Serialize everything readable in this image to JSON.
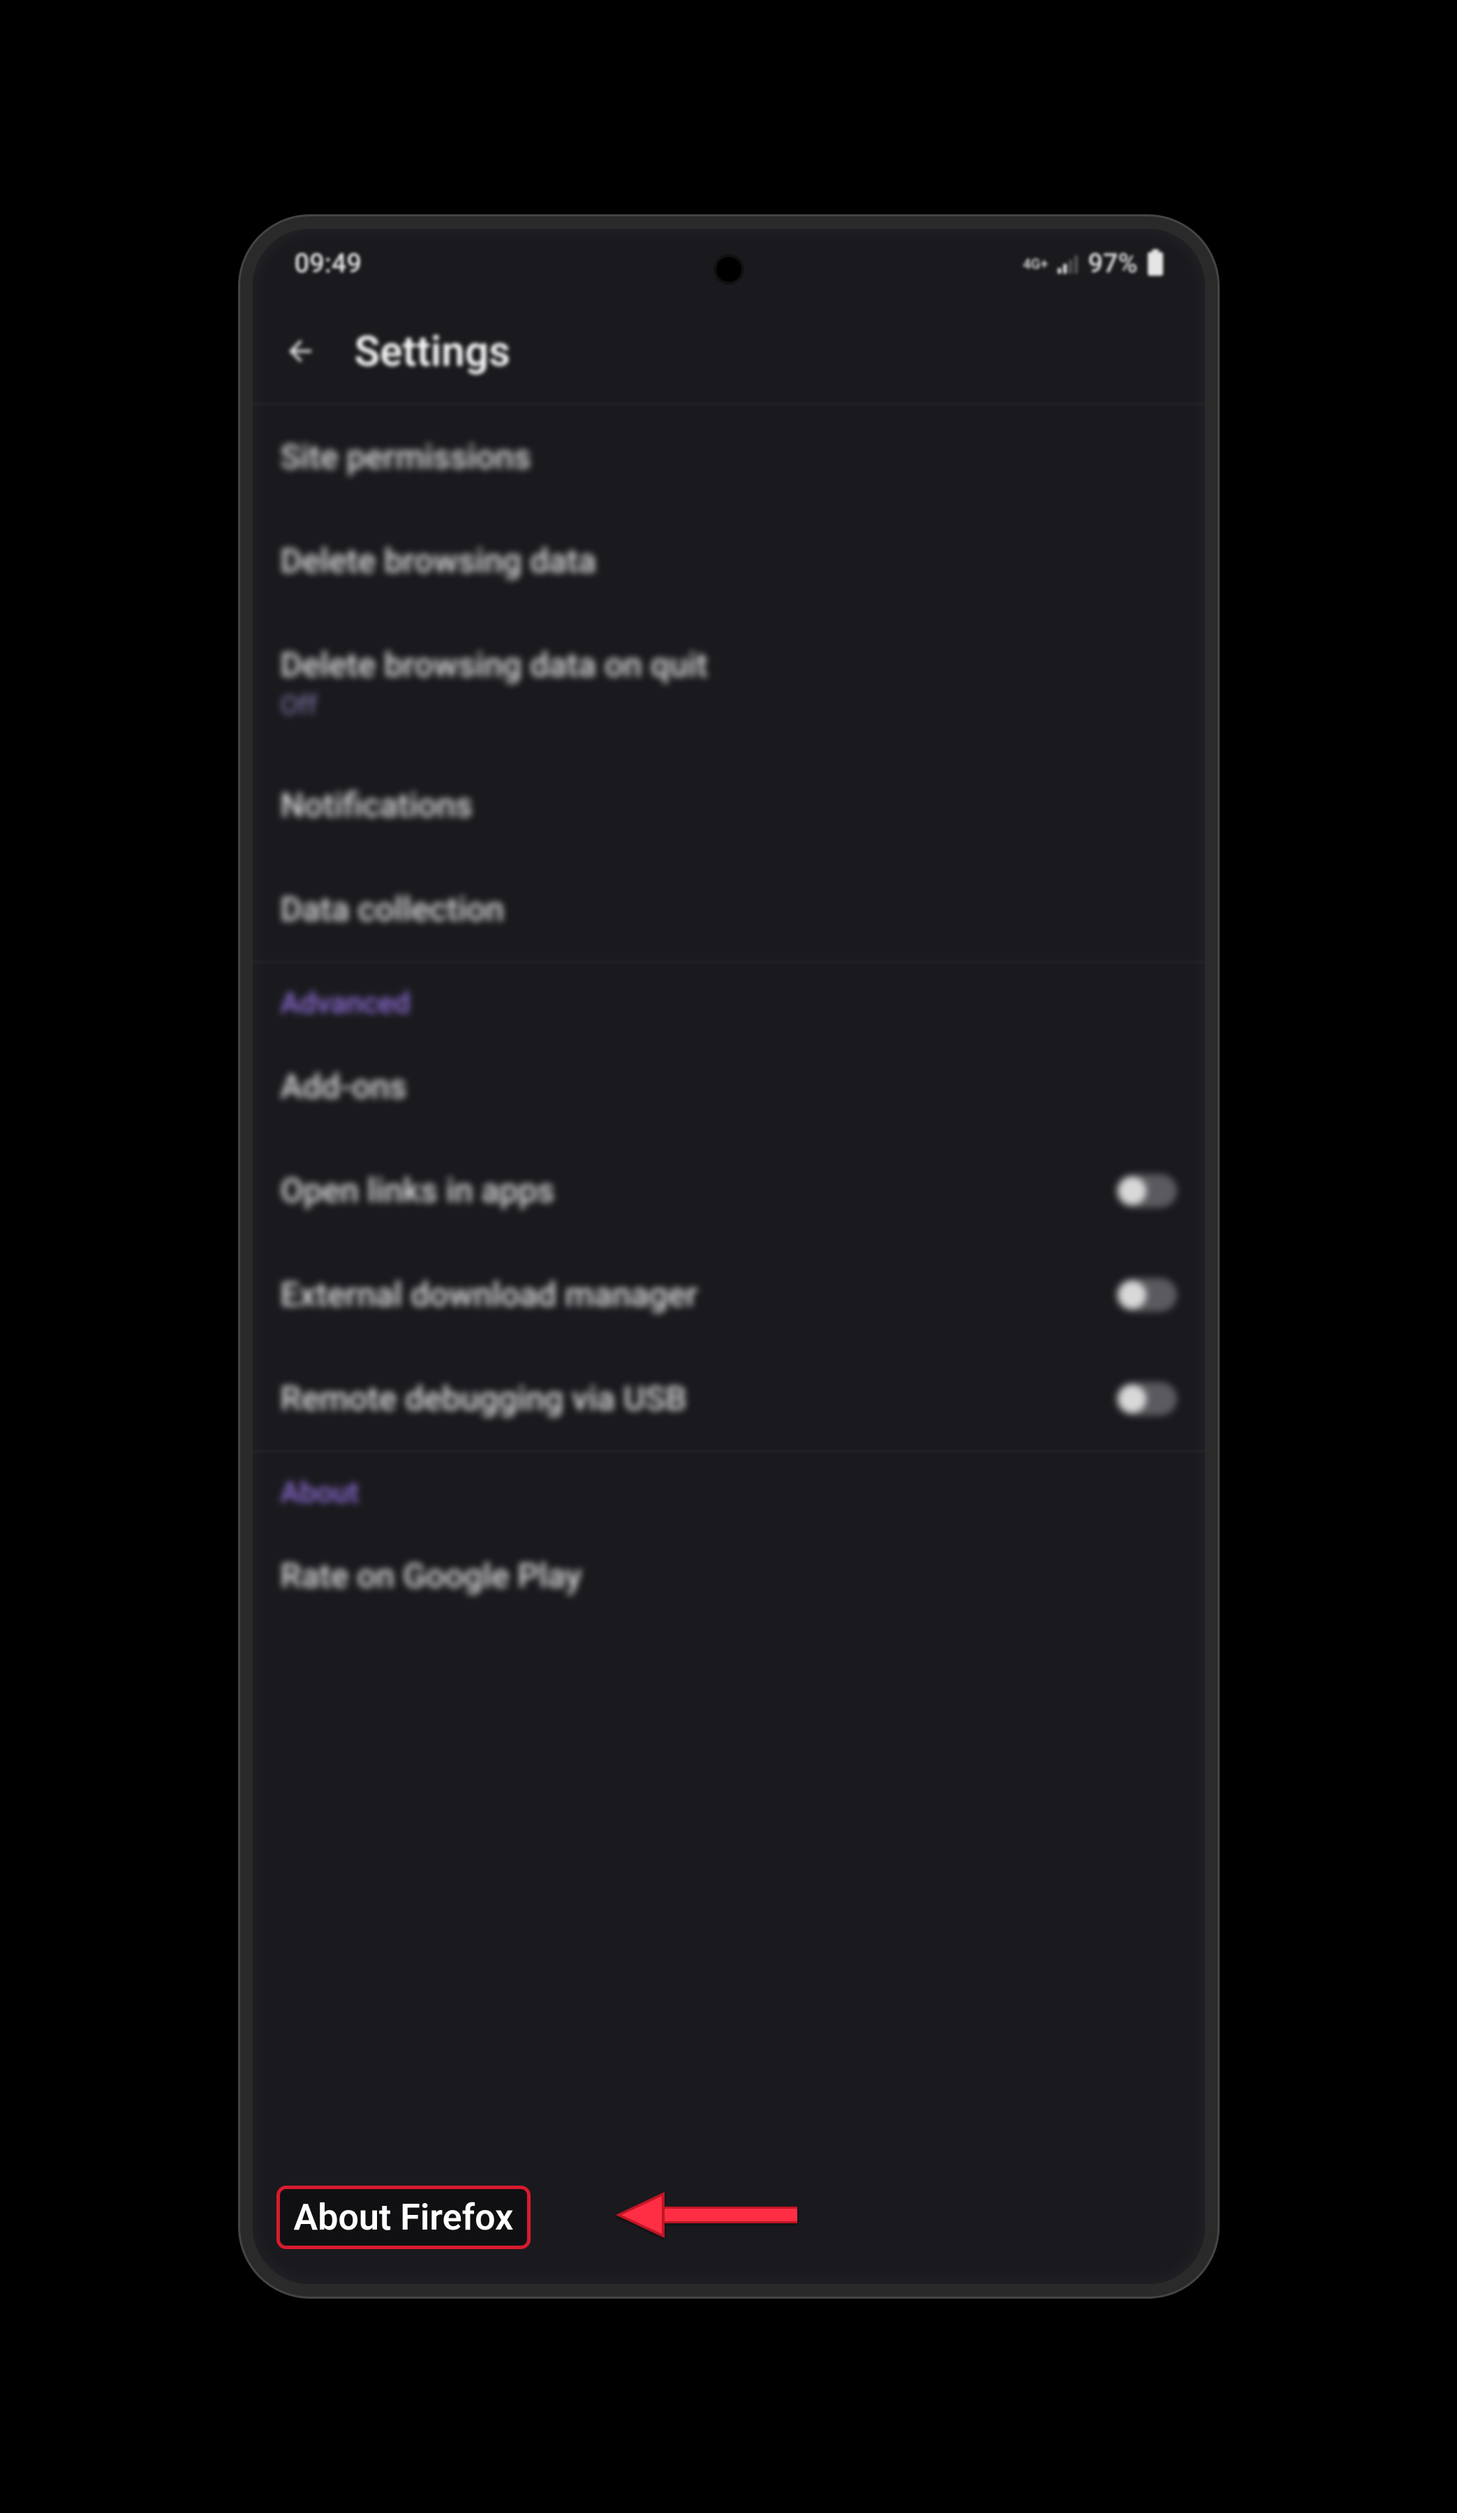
{
  "status": {
    "time": "09:49",
    "network_type": "4G+",
    "battery_pct": "97%"
  },
  "header": {
    "title": "Settings"
  },
  "sections": {
    "privacy_items": [
      {
        "label": "Site permissions"
      },
      {
        "label": "Delete browsing data"
      },
      {
        "label": "Delete browsing data on quit",
        "sub": "Off"
      },
      {
        "label": "Notifications"
      },
      {
        "label": "Data collection"
      }
    ],
    "advanced": {
      "title": "Advanced",
      "items": [
        {
          "label": "Add-ons"
        },
        {
          "label": "Open links in apps",
          "toggle": false
        },
        {
          "label": "External download manager",
          "toggle": false
        },
        {
          "label": "Remote debugging via USB",
          "toggle": false
        }
      ]
    },
    "about": {
      "title": "About",
      "items": [
        {
          "label": "Rate on Google Play"
        },
        {
          "label": "About Firefox"
        }
      ]
    }
  },
  "highlight": {
    "label": "About Firefox"
  },
  "colors": {
    "accent": "#8f6fd8",
    "highlight_border": "#d81b2f",
    "background": "#1a1a1e"
  }
}
